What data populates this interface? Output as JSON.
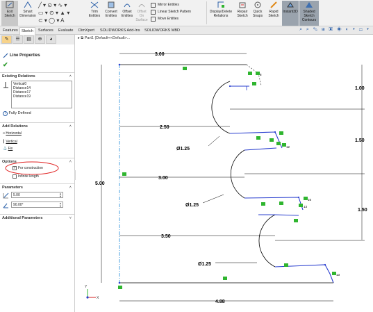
{
  "ribbon": {
    "exit_sketch": "Exit Sketch",
    "smart_dimension": "Smart Dimension",
    "trim_entities": "Trim Entities",
    "convert_entities": "Convert Entities",
    "offset_entities": "Offset Entities",
    "offset_on_surface": "Offset On Surface",
    "mirror_entities": "Mirror Entities",
    "linear_sketch_pattern": "Linear Sketch Pattern",
    "move_entities": "Move Entities",
    "display_delete_relations": "Display/Delete Relations",
    "repair_sketch": "Repair Sketch",
    "quick_snaps": "Quick Snaps",
    "rapid_sketch": "Rapid Sketch",
    "instant3d": "Instant3D",
    "shaded_sketch_contours": "Shaded Sketch Contours"
  },
  "tabs": [
    "Features",
    "Sketch",
    "Surfaces",
    "Evaluate",
    "DimXpert",
    "SOLIDWORKS Add-Ins",
    "SOLIDWORKS MBD"
  ],
  "active_tab": "Sketch",
  "tree": {
    "part_label": "Part1 (Default<<Default>..."
  },
  "property_manager": {
    "title": "Line Properties",
    "existing_relations_header": "Existing Relations",
    "relations": [
      "Vertical0",
      "Distance14",
      "Distance17",
      "Distance19"
    ],
    "status": "Fully Defined",
    "add_relations_header": "Add Relations",
    "add_relations": [
      "Horizontal",
      "Vertical",
      "Fix"
    ],
    "options_header": "Options",
    "for_construction": "For construction",
    "for_construction_checked": true,
    "infinite_length": "Infinite length",
    "infinite_length_checked": false,
    "parameters_header": "Parameters",
    "length_value": "5.00",
    "angle_value": "90.00°",
    "additional_parameters_header": "Additional Parameters"
  },
  "dimensions": {
    "top_width": "3.00",
    "right_top": "1.00",
    "right_mid1": "1.50",
    "right_mid2": "1.50",
    "height": "5.00",
    "cut1_depth": "2.50",
    "cut2_depth": "3.00",
    "cut3_depth": "3.50",
    "dia1": "Ø1.25",
    "dia2": "Ø1.25",
    "dia3": "Ø1.25",
    "bottom_width": "4.88"
  },
  "relation_tags": [
    "8",
    "12",
    "16",
    "13",
    "13"
  ],
  "colors": {
    "sketch_line": "#000000",
    "selected_line": "#2a3fcf",
    "construction_line": "#4aa0e0",
    "relation_marker": "#2fb52f",
    "annotation_circle": "#e02020"
  }
}
